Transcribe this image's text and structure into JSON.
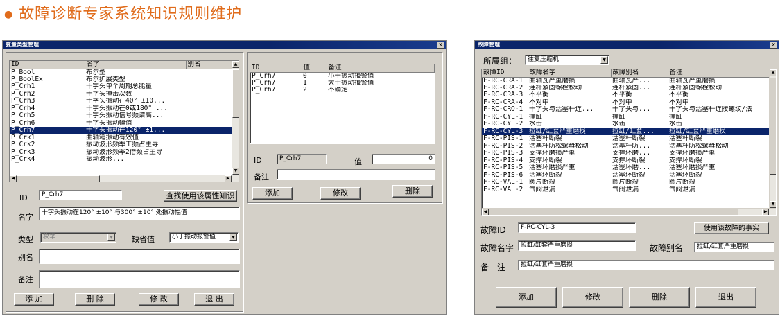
{
  "page": {
    "title": "故障诊断专家系统知识规则维护"
  },
  "left_window": {
    "title": "变量类型管理",
    "close": "x",
    "var_table": {
      "headers": [
        "ID",
        "名字",
        "别名"
      ],
      "rows": [
        [
          "P_Bool",
          "布尔型",
          ""
        ],
        [
          "P_BoolEx",
          "布尔扩展类型",
          ""
        ],
        [
          "P_Crh1",
          "十字头单个周期总能量",
          ""
        ],
        [
          "P_Crh2",
          "十字头撞击次数",
          ""
        ],
        [
          "P_Crh3",
          "十字头振动在40° ±10...",
          ""
        ],
        [
          "P_Crh4",
          "十字头振动在0或180° ...",
          ""
        ],
        [
          "P_Crh5",
          "十字头振动信号频谱高...",
          ""
        ],
        [
          "P_Crh6",
          "十字头振动幅值",
          ""
        ],
        [
          "P_Crh7",
          "十字头振动在120° ±1...",
          ""
        ],
        [
          "P_Crk1",
          "曲轴箱振动有效值",
          ""
        ],
        [
          "P_Crk2",
          "振动波形频率工频占主导",
          ""
        ],
        [
          "P_Crk3",
          "振动波形频率2倍频占主导",
          ""
        ],
        [
          "P_Crk4",
          "振动波形...",
          ""
        ]
      ],
      "selected_index": 8
    },
    "value_table": {
      "headers": [
        "ID",
        "值",
        "备注"
      ],
      "rows": [
        [
          "P_Crh7",
          "0",
          "小于振动报警值"
        ],
        [
          "P_Crh7",
          "1",
          "大于振动报警值"
        ],
        [
          "P_Crh7",
          "2",
          "不确定"
        ]
      ]
    },
    "form": {
      "id_label": "ID",
      "id_value": "P_Crh7",
      "find_button": "查找使用该属性知识",
      "name_label": "名字",
      "name_value": "十字头振动在120° ±10° 与300° ±10° 处振动幅值",
      "type_label": "类型",
      "type_value": "枚举",
      "default_label": "缺省值",
      "default_value": "小于振动报警值",
      "alias_label": "别名",
      "alias_value": "",
      "note_label": "备注",
      "note_value": "",
      "btn_add": "添 加",
      "btn_delete": "删 除",
      "btn_modify": "修 改",
      "btn_exit": "退 出"
    },
    "value_form": {
      "id_label": "ID",
      "id_value": "P_Crh7",
      "value_label": "值",
      "value_value": "0",
      "note_label": "备注",
      "note_value": "",
      "btn_add": "添加",
      "btn_modify": "修改",
      "btn_delete": "删除"
    }
  },
  "right_window": {
    "title": "故障管理",
    "close": "x",
    "group_label": "所属组：",
    "group_value": "往复压缩机",
    "fault_table": {
      "headers": [
        "故障ID",
        "故障名字",
        "故障别名",
        "备注"
      ],
      "rows": [
        [
          "F-RC-CRA-1",
          "曲轴瓦严重磨损",
          "曲轴瓦严...",
          "曲轴瓦严重磨损"
        ],
        [
          "F-RC-CRA-2",
          "连杆紧固螺栓松动",
          "连杆紧固...",
          "连杆紧固螺栓松动"
        ],
        [
          "F-RC-CRA-3",
          "不平衡",
          "不平衡",
          "不平衡"
        ],
        [
          "F-RC-CRA-4",
          "不对中",
          "不对中",
          "不对中"
        ],
        [
          "F-RC-CRO-1",
          "十字头与活塞杆连...",
          "十字头与...",
          "十字头与活塞杆连接螺纹/法"
        ],
        [
          "F-RC-CYL-1",
          "撞缸",
          "撞缸",
          "撞缸"
        ],
        [
          "F-RC-CYL-2",
          "水击",
          "水击",
          "水击"
        ],
        [
          "F-RC-CYL-3",
          "拉缸/缸套严重磨损",
          "拉缸/缸套...",
          "拉缸/缸套严重磨损"
        ],
        [
          "F-RC-PIS-1",
          "活塞杆断裂",
          "活塞杆断裂",
          "活塞杆断裂"
        ],
        [
          "F-RC-PIS-2",
          "活塞杆防松螺母松动",
          "活塞杆防...",
          "活塞杆防松螺母松动"
        ],
        [
          "F-RC-PIS-3",
          "支撑环磨损严重",
          "支撑环磨...",
          "支撑环磨损严重"
        ],
        [
          "F-RC-PIS-4",
          "支撑环断裂",
          "支撑环断裂",
          "支撑环断裂"
        ],
        [
          "F-RC-PIS-5",
          "活塞环磨损严重",
          "活塞环磨...",
          "活塞环磨损严重"
        ],
        [
          "F-RC-PIS-6",
          "活塞环断裂",
          "活塞环断裂",
          "活塞环断裂"
        ],
        [
          "F-RC-VAL-1",
          "阀片断裂",
          "阀片断裂",
          "阀片断裂"
        ],
        [
          "F-RC-VAL-2",
          "气阀泄漏",
          "气阀泄漏",
          "气阀泄漏"
        ]
      ],
      "selected_index": 7
    },
    "form": {
      "id_label": "故障ID",
      "id_value": "F-RC-CYL-3",
      "facts_button": "使用该故障的事实",
      "name_label": "故障名字",
      "name_value": "拉缸/缸套严重磨损",
      "alias_label": "故障别名",
      "alias_value": "拉缸/缸套严重磨损",
      "note_label": "备　注",
      "note_value": "拉缸/缸套严重磨损",
      "btn_add": "添加",
      "btn_modify": "修改",
      "btn_delete": "删除",
      "btn_exit": "退出"
    }
  }
}
